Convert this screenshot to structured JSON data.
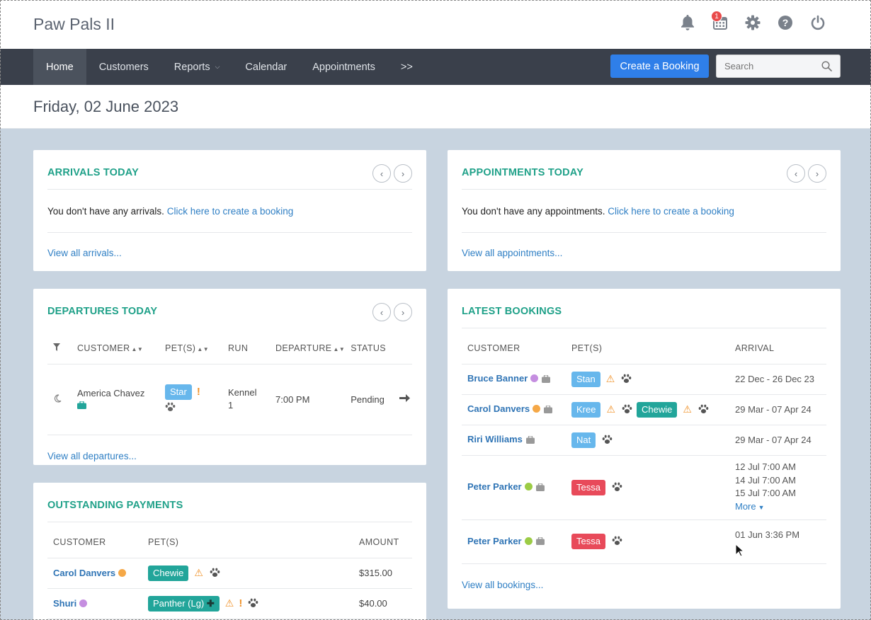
{
  "header": {
    "app_title": "Paw Pals II",
    "notification_count": "1"
  },
  "nav": {
    "items": [
      "Home",
      "Customers",
      "Reports",
      "Calendar",
      "Appointments",
      ">>"
    ],
    "create_booking": "Create a Booking",
    "search_placeholder": "Search"
  },
  "date_title": "Friday, 02 June 2023",
  "arrivals": {
    "title": "ARRIVALS TODAY",
    "empty_text": "You don't have any arrivals.",
    "create_link": "Click here to create a booking",
    "view_all": "View all arrivals..."
  },
  "appointments": {
    "title": "APPOINTMENTS TODAY",
    "empty_text": "You don't have any appointments.",
    "create_link": "Click here to create a booking",
    "view_all": "View all appointments..."
  },
  "departures": {
    "title": "DEPARTURES TODAY",
    "columns": [
      "CUSTOMER",
      "PET(S)",
      "RUN",
      "DEPARTURE",
      "STATUS"
    ],
    "row": {
      "customer": "America Chavez",
      "pet": "Star",
      "run": "Kennel 1",
      "departure": "7:00 PM",
      "status": "Pending"
    },
    "view_all": "View all departures..."
  },
  "latest_bookings": {
    "title": "LATEST BOOKINGS",
    "columns": [
      "CUSTOMER",
      "PET(S)",
      "ARRIVAL"
    ],
    "rows": [
      {
        "customer": "Bruce Banner",
        "pet1": "Stan",
        "arrival": "22 Dec - 26 Dec 23"
      },
      {
        "customer": "Carol Danvers",
        "pet1": "Kree",
        "pet2": "Chewie",
        "arrival": "29 Mar - 07 Apr 24"
      },
      {
        "customer": "Riri Williams",
        "pet1": "Nat",
        "arrival": "29 Mar - 07 Apr 24"
      },
      {
        "customer": "Peter Parker",
        "pet1": "Tessa",
        "arrival_lines": [
          "12 Jul 7:00 AM",
          "14 Jul 7:00 AM",
          "15 Jul 7:00 AM"
        ],
        "more": "More"
      },
      {
        "customer": "Peter Parker",
        "pet1": "Tessa",
        "arrival": "01 Jun 3:36 PM"
      }
    ],
    "view_all": "View all bookings..."
  },
  "payments": {
    "title": "OUTSTANDING PAYMENTS",
    "columns": [
      "CUSTOMER",
      "PET(S)",
      "AMOUNT"
    ],
    "rows": [
      {
        "customer": "Carol Danvers",
        "pet": "Chewie",
        "amount": "$315.00"
      },
      {
        "customer": "Shuri",
        "pet": "Panther (Lg)",
        "amount": "$40.00"
      }
    ]
  },
  "colors": {
    "accent": "#20a189",
    "nav_bg": "#3a404b",
    "button_blue": "#2f7fe9",
    "dot_purple": "#c58ee0",
    "dot_orange": "#f5a847",
    "dot_green": "#9ccc45"
  }
}
